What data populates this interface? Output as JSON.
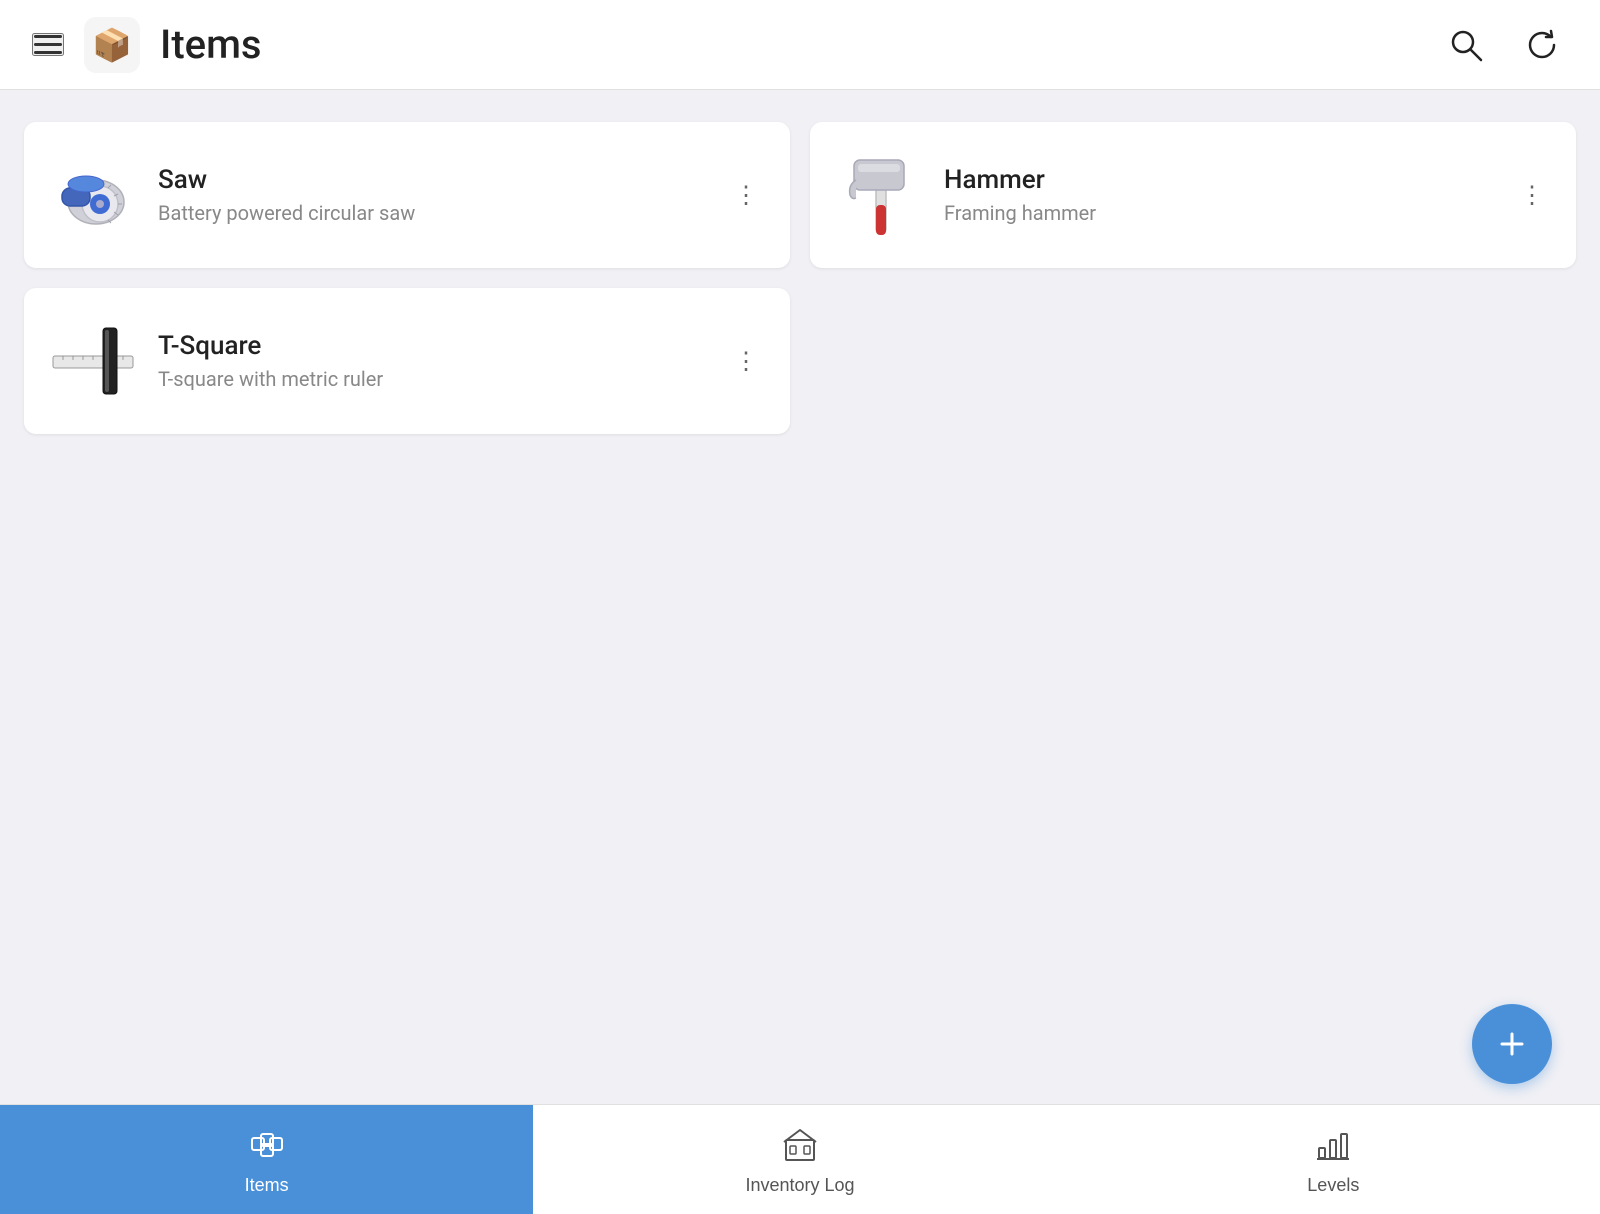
{
  "header": {
    "title": "Items",
    "app_icon": "📦"
  },
  "items": [
    {
      "id": "saw",
      "name": "Saw",
      "description": "Battery powered circular saw"
    },
    {
      "id": "hammer",
      "name": "Hammer",
      "description": "Framing hammer"
    },
    {
      "id": "tsquare",
      "name": "T-Square",
      "description": "T-square with metric ruler"
    }
  ],
  "fab": {
    "label": "Add item"
  },
  "bottom_nav": [
    {
      "id": "items",
      "label": "Items",
      "active": true
    },
    {
      "id": "inventory-log",
      "label": "Inventory Log",
      "active": false
    },
    {
      "id": "levels",
      "label": "Levels",
      "active": false
    }
  ]
}
